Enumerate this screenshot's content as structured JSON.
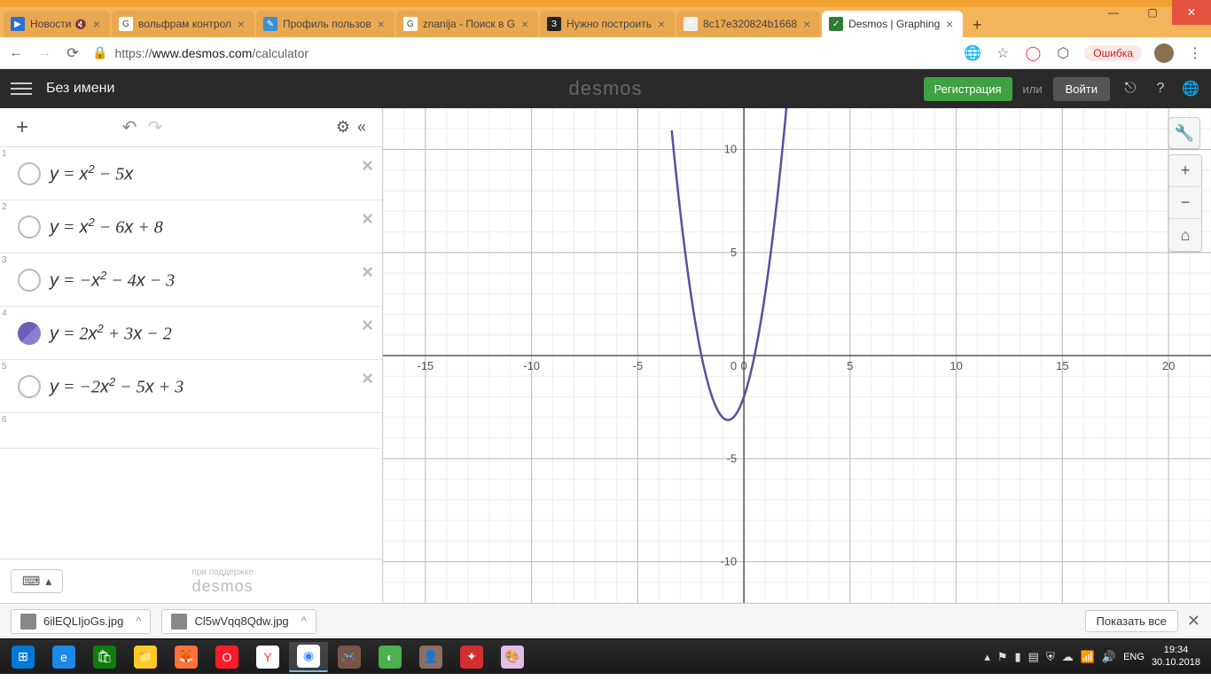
{
  "window": {
    "tabs": [
      {
        "title": "Новости",
        "favicon_bg": "#2a6fd6",
        "favicon_text": "▶",
        "muted": true
      },
      {
        "title": "вольфрам контрол",
        "favicon_bg": "#fff",
        "favicon_text": "G"
      },
      {
        "title": "Профиль пользов",
        "favicon_bg": "#3b8fd6",
        "favicon_text": "✎"
      },
      {
        "title": "znanija - Поиск в G",
        "favicon_bg": "#fff",
        "favicon_text": "G"
      },
      {
        "title": "Нужно построить",
        "favicon_bg": "#222",
        "favicon_text": "З"
      },
      {
        "title": "8c17e320824b1668",
        "favicon_bg": "#eee",
        "favicon_text": "🗎"
      },
      {
        "title": "Desmos | Graphing",
        "favicon_bg": "#2e7d32",
        "favicon_text": "✓",
        "active": true
      }
    ],
    "url_prefix": "https://",
    "url_host": "www.desmos.com",
    "url_path": "/calculator",
    "error_label": "Ошибка"
  },
  "desmos": {
    "title": "Без имени",
    "logo": "desmos",
    "register": "Регистрация",
    "or": "или",
    "login": "Войти"
  },
  "expressions": [
    {
      "n": "1",
      "html": "<i>y</i> = <i>x</i><sup>2</sup> − 5<i>x</i>"
    },
    {
      "n": "2",
      "html": "<i>y</i> = <i>x</i><sup>2</sup> − 6<i>x</i> + 8"
    },
    {
      "n": "3",
      "html": "<i>y</i> = −<i>x</i><sup>2</sup> − 4<i>x</i> − 3"
    },
    {
      "n": "4",
      "html": "<i>y</i> = 2<i>x</i><sup>2</sup> + 3<i>x</i> − 2",
      "active": true
    },
    {
      "n": "5",
      "html": "<i>y</i> = −2<i>x</i><sup>2</sup> − 5<i>x</i> + 3"
    },
    {
      "n": "6",
      "html": "",
      "empty": true
    }
  ],
  "sidebar_footer": {
    "powered": "при поддержке",
    "logo": "desmos"
  },
  "chart_data": {
    "type": "line",
    "title": "",
    "xlabel": "",
    "ylabel": "",
    "xlim": [
      -17,
      22
    ],
    "ylim": [
      -12,
      12
    ],
    "xticks": [
      -15,
      -10,
      -5,
      0,
      5,
      10,
      15,
      20
    ],
    "yticks": [
      -10,
      -5,
      5,
      10
    ],
    "series": [
      {
        "name": "y = 2x² + 3x − 2",
        "color": "#5b4f9e",
        "x": [
          -3.2,
          -3,
          -2.5,
          -2,
          -1.5,
          -1,
          -0.75,
          -0.5,
          -0.25,
          0,
          0.25,
          0.5,
          1,
          1.5,
          2,
          2.2
        ],
        "y": [
          8.88,
          7,
          4,
          2,
          -0.5,
          -3,
          -3.125,
          -3,
          -2.375,
          -2,
          -1.125,
          0,
          3,
          7,
          12,
          14.36
        ]
      }
    ],
    "grid": true
  },
  "downloads": {
    "items": [
      "6ilEQLIjoGs.jpg",
      "Cl5wVqq8Qdw.jpg"
    ],
    "show_all": "Показать все"
  },
  "taskbar": {
    "lang": "ENG",
    "time": "19:34",
    "date": "30.10.2018"
  }
}
